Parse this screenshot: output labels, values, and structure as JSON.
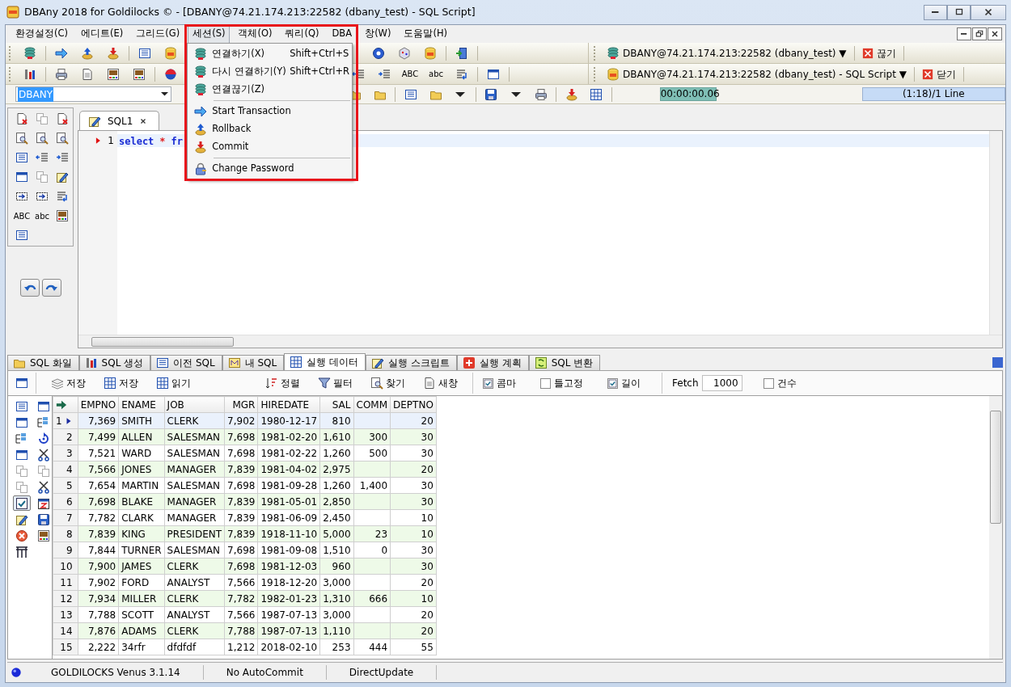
{
  "window": {
    "title": "DBAny 2018 for Goldilocks © - [DBANY@74.21.174.213:22582 (dbany_test) - SQL Script]"
  },
  "menu": [
    {
      "label": "환경설정(C)",
      "selected": false
    },
    {
      "label": "에디트(E)",
      "selected": false
    },
    {
      "label": "그리드(G)",
      "selected": false
    },
    {
      "label": "세션(S)",
      "selected": true
    },
    {
      "label": "객체(O)",
      "selected": false
    },
    {
      "label": "쿼리(Q)",
      "selected": false
    },
    {
      "label": "DBA",
      "selected": false
    },
    {
      "label": "창(W)",
      "selected": false
    },
    {
      "label": "도움말(H)",
      "selected": false
    }
  ],
  "session_menu": [
    {
      "kind": "item",
      "label": "연결하기(X)",
      "shortcut": "Shift+Ctrl+S"
    },
    {
      "kind": "item",
      "label": "다시 연결하기(Y)",
      "shortcut": "Shift+Ctrl+R"
    },
    {
      "kind": "item",
      "label": "연결끊기(Z)"
    },
    {
      "kind": "separator"
    },
    {
      "kind": "item",
      "label": "Start Transaction"
    },
    {
      "kind": "item",
      "label": "Rollback"
    },
    {
      "kind": "item",
      "label": "Commit"
    },
    {
      "kind": "separator"
    },
    {
      "kind": "item",
      "label": "Change Password"
    }
  ],
  "toolbar": {
    "connection": "DBANY@74.21.174.213:22582 (dbany_test) ▼",
    "disconnect": "끊기",
    "window": "DBANY@74.21.174.213:22582 (dbany_test) - SQL Script ▼",
    "close": "닫기",
    "case_labels": [
      "ABC",
      "abc"
    ],
    "database": "DBANY",
    "elapsed": "00:00:00.06",
    "position": "(1:18)/1 Line"
  },
  "side_panel": {
    "case_labels": [
      "ABC",
      "abc"
    ]
  },
  "editor": {
    "tabs": [
      {
        "label": "SQL1",
        "selected": true
      }
    ],
    "lines": [
      {
        "number": "1",
        "tokens": [
          {
            "kind": "keyword",
            "text": "select"
          },
          {
            "kind": "operator",
            "text": "*"
          },
          {
            "kind": "keyword",
            "text": "fr"
          }
        ]
      }
    ]
  },
  "result_tabs": [
    {
      "label": "SQL 화일",
      "selected": false
    },
    {
      "label": "SQL 생성",
      "selected": false
    },
    {
      "label": "이전 SQL",
      "selected": false
    },
    {
      "label": "내 SQL",
      "selected": false
    },
    {
      "label": "실행 데이터",
      "selected": true
    },
    {
      "label": "실행 스크립트",
      "selected": false
    },
    {
      "label": "실행 계획",
      "selected": false
    },
    {
      "label": "SQL 변환",
      "selected": false
    }
  ],
  "grid_toolbar": {
    "buttons": [
      {
        "label": "저장"
      },
      {
        "label": "저장"
      },
      {
        "label": "읽기"
      },
      {
        "label": "정렬"
      },
      {
        "label": "필터"
      },
      {
        "label": "찾기"
      },
      {
        "label": "새창"
      }
    ],
    "options": [
      {
        "label": "콤마",
        "checked": true
      },
      {
        "label": "틀고정",
        "checked": false
      },
      {
        "label": "길이",
        "checked": true
      }
    ],
    "fetch_label": "Fetch",
    "fetch_value": "1000",
    "count": {
      "label": "건수",
      "checked": false
    }
  },
  "grid": {
    "columns": [
      {
        "label": "EMPNO",
        "numeric": true
      },
      {
        "label": "ENAME",
        "numeric": false
      },
      {
        "label": "JOB",
        "numeric": false
      },
      {
        "label": "MGR",
        "numeric": true
      },
      {
        "label": "HIREDATE",
        "numeric": false
      },
      {
        "label": "SAL",
        "numeric": true
      },
      {
        "label": "COMM",
        "numeric": true
      },
      {
        "label": "DEPTNO",
        "numeric": true
      }
    ],
    "rows": [
      {
        "number": "1",
        "selected": true,
        "cells": [
          "7,369",
          "SMITH",
          "CLERK",
          "7,902",
          "1980-12-17",
          "810",
          "",
          "20"
        ]
      },
      {
        "number": "2",
        "selected": false,
        "cells": [
          "7,499",
          "ALLEN",
          "SALESMAN",
          "7,698",
          "1981-02-20",
          "1,610",
          "300",
          "30"
        ]
      },
      {
        "number": "3",
        "selected": false,
        "cells": [
          "7,521",
          "WARD",
          "SALESMAN",
          "7,698",
          "1981-02-22",
          "1,260",
          "500",
          "30"
        ]
      },
      {
        "number": "4",
        "selected": false,
        "cells": [
          "7,566",
          "JONES",
          "MANAGER",
          "7,839",
          "1981-04-02",
          "2,975",
          "",
          "20"
        ]
      },
      {
        "number": "5",
        "selected": false,
        "cells": [
          "7,654",
          "MARTIN",
          "SALESMAN",
          "7,698",
          "1981-09-28",
          "1,260",
          "1,400",
          "30"
        ]
      },
      {
        "number": "6",
        "selected": false,
        "cells": [
          "7,698",
          "BLAKE",
          "MANAGER",
          "7,839",
          "1981-05-01",
          "2,850",
          "",
          "30"
        ]
      },
      {
        "number": "7",
        "selected": false,
        "cells": [
          "7,782",
          "CLARK",
          "MANAGER",
          "7,839",
          "1981-06-09",
          "2,450",
          "",
          "10"
        ]
      },
      {
        "number": "8",
        "selected": false,
        "cells": [
          "7,839",
          "KING",
          "PRESIDENT",
          "7,839",
          "1918-11-10",
          "5,000",
          "23",
          "10"
        ]
      },
      {
        "number": "9",
        "selected": false,
        "cells": [
          "7,844",
          "TURNER",
          "SALESMAN",
          "7,698",
          "1981-09-08",
          "1,510",
          "0",
          "30"
        ]
      },
      {
        "number": "10",
        "selected": false,
        "cells": [
          "7,900",
          "JAMES",
          "CLERK",
          "7,698",
          "1981-12-03",
          "960",
          "",
          "30"
        ]
      },
      {
        "number": "11",
        "selected": false,
        "cells": [
          "7,902",
          "FORD",
          "ANALYST",
          "7,566",
          "1918-12-20",
          "3,000",
          "",
          "20"
        ]
      },
      {
        "number": "12",
        "selected": false,
        "cells": [
          "7,934",
          "MILLER",
          "CLERK",
          "7,782",
          "1982-01-23",
          "1,310",
          "666",
          "10"
        ]
      },
      {
        "number": "13",
        "selected": false,
        "cells": [
          "7,788",
          "SCOTT",
          "ANALYST",
          "7,566",
          "1987-07-13",
          "3,000",
          "",
          "20"
        ]
      },
      {
        "number": "14",
        "selected": false,
        "cells": [
          "7,876",
          "ADAMS",
          "CLERK",
          "7,788",
          "1987-07-13",
          "1,110",
          "",
          "20"
        ]
      },
      {
        "number": "15",
        "selected": false,
        "cells": [
          "2,222",
          "34rfr",
          "dfdfdf",
          "1,212",
          "2018-02-10",
          "253",
          "444",
          "55"
        ]
      }
    ]
  },
  "status_bar": [
    "GOLDILOCKS Venus 3.1.14",
    "No AutoCommit",
    "DirectUpdate"
  ]
}
